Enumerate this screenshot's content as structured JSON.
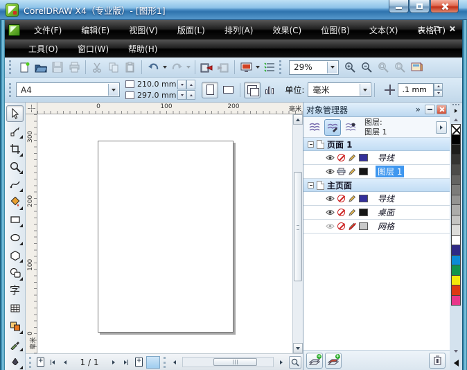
{
  "titlebar": {
    "title": "CorelDRAW X4（专业版）- [图形1]"
  },
  "menubar": {
    "row1": [
      "文件(F)",
      "编辑(E)",
      "视图(V)",
      "版面(L)",
      "排列(A)",
      "效果(C)",
      "位图(B)",
      "文本(X)",
      "表格(T)"
    ],
    "row2": [
      "工具(O)",
      "窗口(W)",
      "帮助(H)"
    ]
  },
  "toolbar": {
    "zoom_value": "29%"
  },
  "property_bar": {
    "paper_type": "A4",
    "paper_width": "210.0 mm",
    "paper_height": "297.0 mm",
    "units_label": "单位:",
    "units_value": "毫米",
    "nudge_value": ".1 mm"
  },
  "rulers": {
    "h_labels": [
      "0",
      "100",
      "200"
    ],
    "h_unit": "毫米",
    "v_labels": [
      "300",
      "200",
      "100",
      "0"
    ],
    "v_unit": "毫米"
  },
  "toolbox": {
    "tools": [
      "pick-tool",
      "shape-tool",
      "crop-tool",
      "zoom-tool",
      "freehand-tool",
      "smart-fill-tool",
      "rectangle-tool",
      "ellipse-tool",
      "polygon-tool",
      "basic-shapes-tool",
      "text-tool",
      "table-tool",
      "interactive-blend-tool",
      "eyedropper-tool",
      "outline-tool"
    ],
    "text_tool_glyph": "字"
  },
  "docker": {
    "title": "对象管理器",
    "chevrons": "»",
    "layer_caption": "图层:",
    "layer_current": "图层 1",
    "groups": [
      {
        "name": "页面 1",
        "rows": [
          {
            "name": "导线",
            "visible": true,
            "printable": false,
            "editable": true,
            "swatch": "#34309b",
            "selected": false,
            "italic": true
          },
          {
            "name": "图层 1",
            "visible": true,
            "printable": true,
            "editable": true,
            "swatch": "#161616",
            "selected": true,
            "italic": false
          }
        ]
      },
      {
        "name": "主页面",
        "rows": [
          {
            "name": "导线",
            "visible": true,
            "printable": false,
            "editable": true,
            "swatch": "#34309b",
            "selected": false,
            "italic": true
          },
          {
            "name": "桌面",
            "visible": true,
            "printable": false,
            "editable": true,
            "swatch": "#161616",
            "selected": false,
            "italic": true
          },
          {
            "name": "网格",
            "visible": false,
            "printable": false,
            "editable": false,
            "swatch": "#c9c9c9",
            "selected": false,
            "italic": true
          }
        ]
      }
    ]
  },
  "canvas": {
    "page_indicator": "1 / 1"
  },
  "palette": {
    "colors": [
      "none",
      "#000000",
      "#1d1d1b",
      "#343432",
      "#4c4c4a",
      "#646462",
      "#7c7c7a",
      "#949492",
      "#acacaa",
      "#c4c4c2",
      "#dcdcda",
      "#ffffff",
      "#2e2a86",
      "#0c8bd6",
      "#12934d",
      "#f3ea0b",
      "#dd3912",
      "#e9368a"
    ]
  },
  "theme": {
    "selected_layer_bg": "#3f97ef",
    "titlebar_blue": "#4a8cc4",
    "toolbar_bg": "#c9dcec",
    "menubar_bg": "#111111"
  }
}
